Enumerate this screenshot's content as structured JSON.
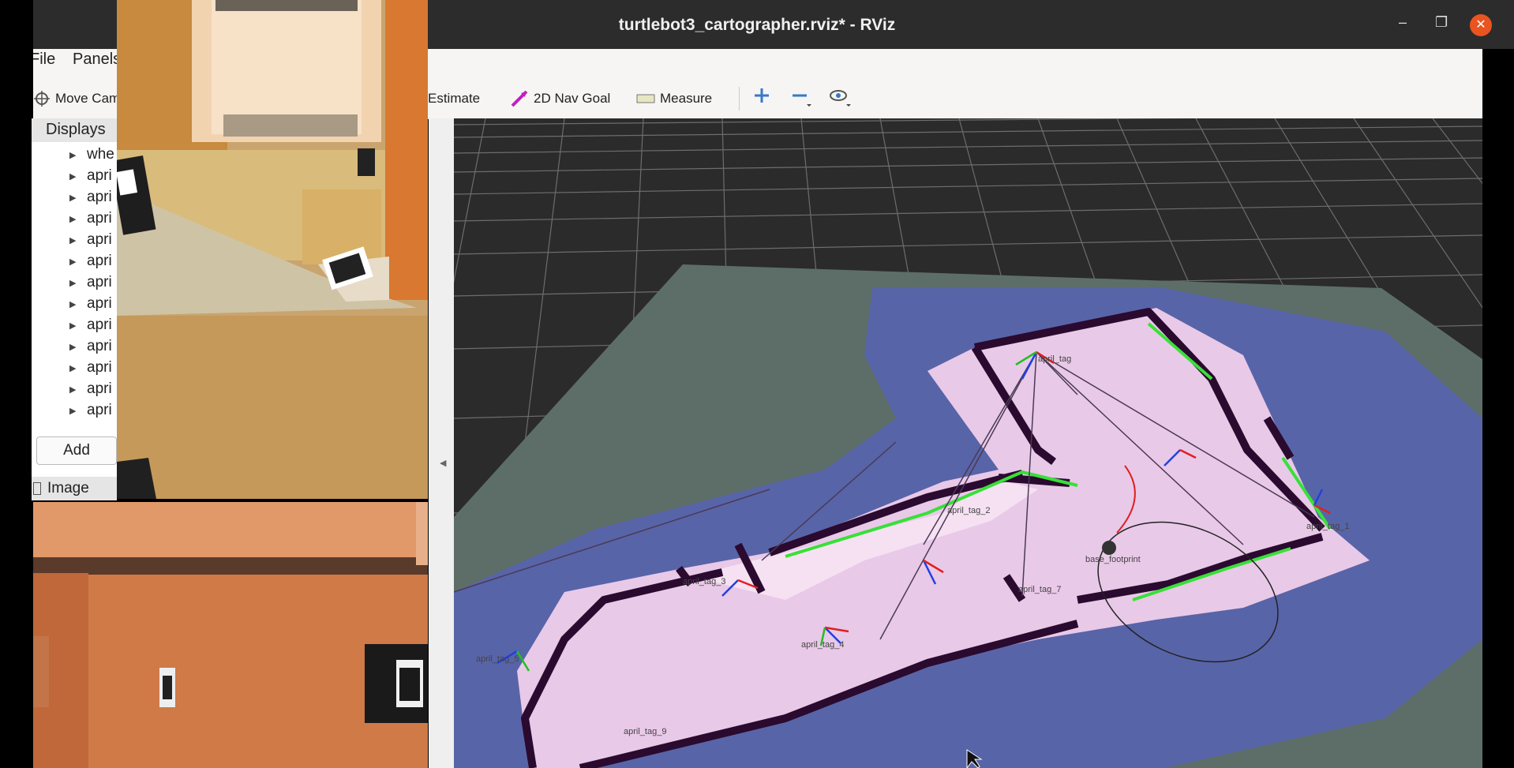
{
  "window": {
    "title": "turtlebot3_cartographer.rviz* - RViz",
    "minimize": "–",
    "restore": "❐",
    "close": "✕"
  },
  "menu": {
    "file": "File",
    "panels": "Panels"
  },
  "toolbar": {
    "move_camera": "Move Cam",
    "pose_estimate": "Estimate",
    "nav_goal": "2D Nav Goal",
    "measure": "Measure"
  },
  "displays": {
    "header": "Displays",
    "items": [
      "whe",
      "apri",
      "apri",
      "apri",
      "apri",
      "apri",
      "apri",
      "apri",
      "apri",
      "apri",
      "apri",
      "apri",
      "apri"
    ],
    "add_label": "Add",
    "image_label": "Image"
  },
  "map_labels": {
    "tag_left": "april_tag_5",
    "tag_mid": "april_tag_3",
    "tag_center": "april_tag_4",
    "tag_bottom": "april_tag_9",
    "tag_right": "april_tag_1",
    "tag_far": "april_tag_7",
    "tag_top": "april_tag",
    "tag_base": "april_tag_2",
    "robot": "base_footprint"
  },
  "colors": {
    "titlebar": "#2c2c2c",
    "close_button": "#e95420",
    "grid_background": "#2b2b2b",
    "costmap_blue": "#5a64a6",
    "free_space": "#e8c8e6",
    "obstacle": "#2a0a2e",
    "lidar_green": "#38e038"
  }
}
